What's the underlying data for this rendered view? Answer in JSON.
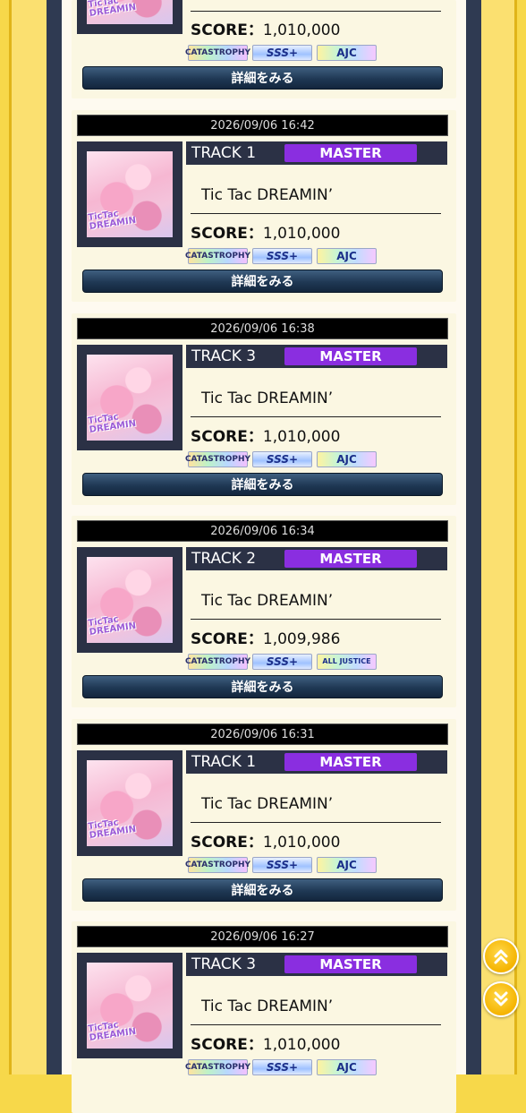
{
  "top_partial": {
    "score_label": "SCORE：",
    "score": "1,010,000",
    "lamps": [
      "CATASTROPHY",
      "SSS+",
      "AJC"
    ],
    "detail_label": "詳細をみる"
  },
  "entries": [
    {
      "date": "2026/09/06 16:42",
      "track": "TRACK 1",
      "difficulty": "MASTER",
      "title": "Tic Tac DREAMIN’",
      "score_label": "SCORE：",
      "score": "1,010,000",
      "lamps": [
        "CATASTROPHY",
        "SSS+",
        "AJC"
      ],
      "detail_label": "詳細をみる"
    },
    {
      "date": "2026/09/06 16:38",
      "track": "TRACK 3",
      "difficulty": "MASTER",
      "title": "Tic Tac DREAMIN’",
      "score_label": "SCORE：",
      "score": "1,010,000",
      "lamps": [
        "CATASTROPHY",
        "SSS+",
        "AJC"
      ],
      "detail_label": "詳細をみる"
    },
    {
      "date": "2026/09/06 16:34",
      "track": "TRACK 2",
      "difficulty": "MASTER",
      "title": "Tic Tac DREAMIN’",
      "score_label": "SCORE：",
      "score": "1,009,986",
      "lamps": [
        "CATASTROPHY",
        "SSS+",
        "ALL JUSTICE"
      ],
      "detail_label": "詳細をみる"
    },
    {
      "date": "2026/09/06 16:31",
      "track": "TRACK 1",
      "difficulty": "MASTER",
      "title": "Tic Tac DREAMIN’",
      "score_label": "SCORE：",
      "score": "1,010,000",
      "lamps": [
        "CATASTROPHY",
        "SSS+",
        "AJC"
      ],
      "detail_label": "詳細をみる"
    },
    {
      "date": "2026/09/06 16:27",
      "track": "TRACK 3",
      "difficulty": "MASTER",
      "title": "Tic Tac DREAMIN’",
      "score_label": "SCORE：",
      "score": "1,010,000",
      "lamps": [
        "CATASTROPHY",
        "SSS+",
        "AJC"
      ],
      "detail_label": ""
    }
  ],
  "jacket_logo": "TicTac DREAMIN",
  "scroll_buttons": [
    {
      "name": "scroll-to-top-button",
      "icon": "double-chevron-up-icon"
    },
    {
      "name": "scroll-to-bottom-button",
      "icon": "double-chevron-down-icon"
    }
  ],
  "colors": {
    "background_yellow": "#f7d84a",
    "nav_stripe": "#2f3a52",
    "difficulty_master": "#8a2ee0",
    "scroll_button": "#f5b400"
  }
}
